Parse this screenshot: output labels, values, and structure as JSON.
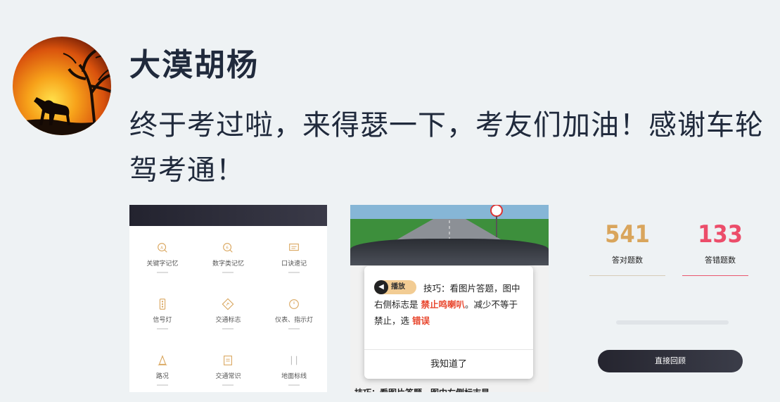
{
  "post": {
    "username": "大漠胡杨",
    "text": "终于考过啦，来得瑟一下，考友们加油！感谢车轮驾考通！"
  },
  "screenshot_1": {
    "items": [
      {
        "label": "关键字记忆",
        "icon": "magnifier-a-icon"
      },
      {
        "label": "数字类记忆",
        "icon": "magnifier-6-icon"
      },
      {
        "label": "口诀速记",
        "icon": "message-icon"
      },
      {
        "label": "信号灯",
        "icon": "traffic-light-icon"
      },
      {
        "label": "交通标志",
        "icon": "sign-diamond-icon"
      },
      {
        "label": "仪表、指示灯",
        "icon": "gauge-icon"
      },
      {
        "label": "路况",
        "icon": "cone-icon"
      },
      {
        "label": "交通常识",
        "icon": "document-icon"
      },
      {
        "label": "地面标线",
        "icon": "lane-lines-icon"
      }
    ]
  },
  "screenshot_2": {
    "play_badge": "播放",
    "tip_part1": "技巧：看图片答题，图中右侧标志是",
    "tip_highlight": "禁止鸣喇叭",
    "tip_part2": "。减少不等于禁止，选",
    "tip_answer": "错误",
    "confirm_button": "我知道了",
    "bottom_peek": "技巧：看图片答题，图中右侧标志是"
  },
  "screenshot_3": {
    "correct_count": "541",
    "correct_label": "答对题数",
    "correct_color": "#d9a55c",
    "wrong_count": "133",
    "wrong_label": "答错题数",
    "wrong_color": "#ec4d6a",
    "review_button": "直接回顾"
  }
}
